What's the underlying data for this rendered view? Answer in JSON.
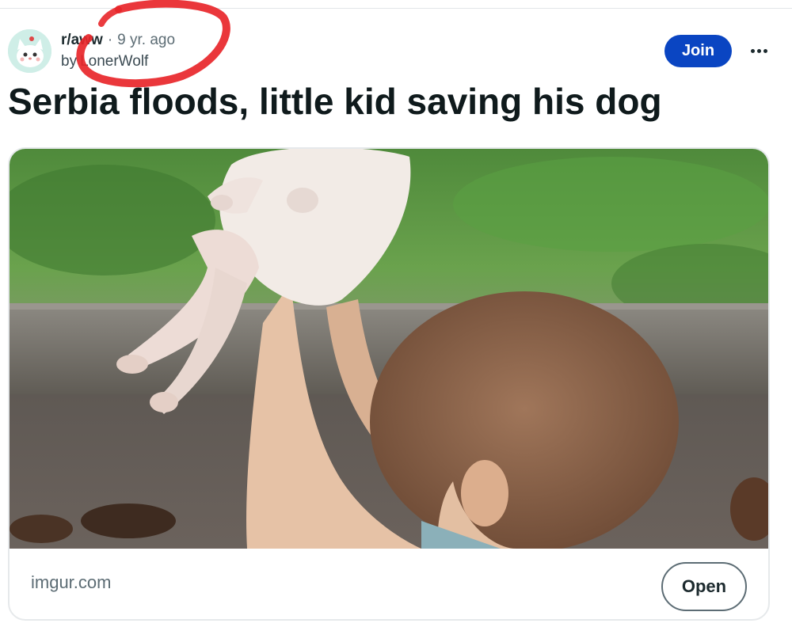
{
  "post": {
    "subreddit": "r/aww",
    "separator": "·",
    "age": "9 yr. ago",
    "by_prefix": "by",
    "author": "LonerWolf",
    "title": "Serbia floods, little kid saving his dog",
    "join_label": "Join"
  },
  "link_card": {
    "domain": "imgur.com",
    "open_label": "Open"
  },
  "icons": {
    "avatar": "subreddit-avatar-icon",
    "more": "more-options-icon"
  },
  "colors": {
    "join_button": "#0a45c2",
    "annotation": "#e8262a"
  }
}
